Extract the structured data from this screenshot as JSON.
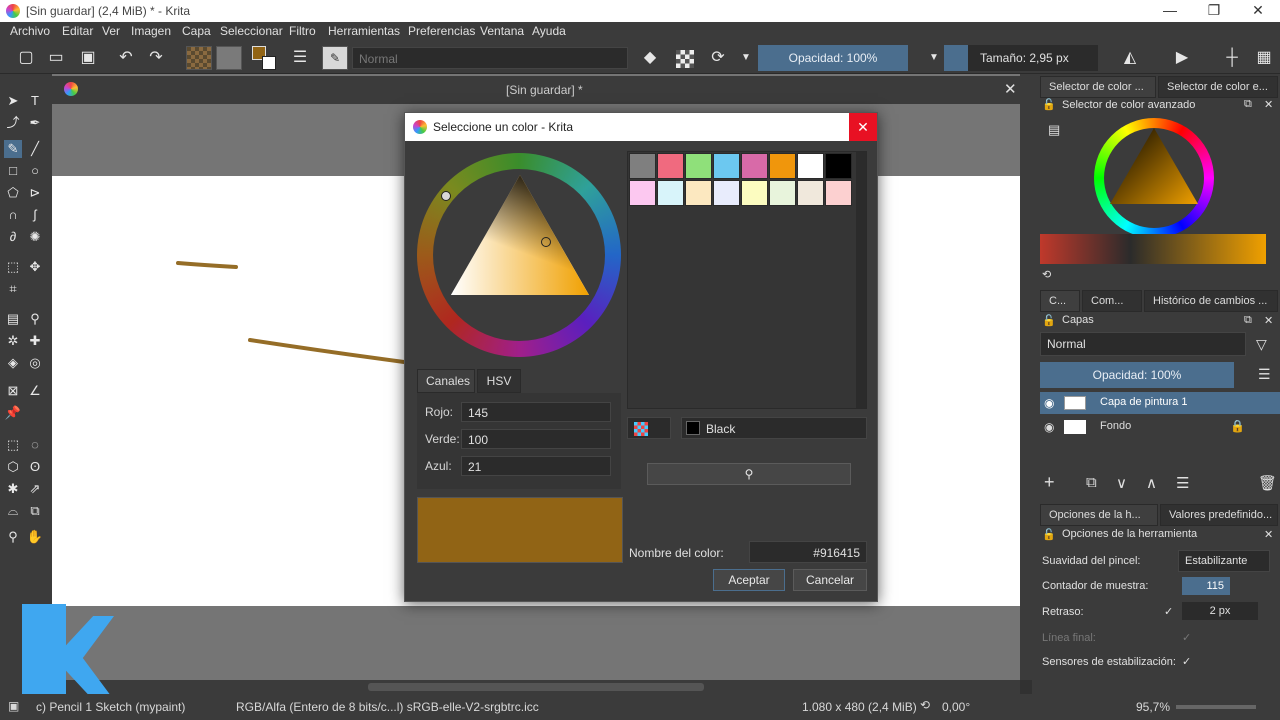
{
  "window": {
    "title": "[Sin guardar]  (2,4 MiB)  * - Krita",
    "min": "—",
    "max": "❐",
    "close": "✕"
  },
  "menu": [
    "Archivo",
    "Editar",
    "Ver",
    "Imagen",
    "Capa",
    "Seleccionar",
    "Filtro",
    "Herramientas",
    "Preferencias",
    "Ventana",
    "Ayuda"
  ],
  "toolbar": {
    "blend_mode": "Normal",
    "opacity": "Opacidad: 100%",
    "size": "Tamaño: 2,95 px"
  },
  "document": {
    "tab_title": "[Sin guardar]  *",
    "close": "✕"
  },
  "right_panel": {
    "top_tabs": [
      "Selector de color ...",
      "Selector de color e..."
    ],
    "color_selector_title": "Selector de color avanzado",
    "mid_tabs": [
      "C...",
      "Com...",
      "Histórico de cambios ..."
    ],
    "layers_title": "Capas",
    "layers_blend": "Normal",
    "layers_opacity": "Opacidad:  100%",
    "layers": [
      {
        "name": "Capa de pintura 1"
      },
      {
        "name": "Fondo"
      }
    ],
    "bottom_tabs": [
      "Opciones de la h...",
      "Valores predefinido..."
    ],
    "tool_options_title": "Opciones de la herramienta",
    "tool_options": {
      "smoothing_label": "Suavidad del pincel:",
      "smoothing_value": "Estabilizante",
      "sample_label": "Contador de muestra:",
      "sample_value": "115",
      "delay_label": "Retraso:",
      "delay_value": "2 px",
      "finish_label": "Línea final:",
      "sensors_label": "Sensores de estabilización:"
    }
  },
  "dialog": {
    "title": "Seleccione un color - Krita",
    "tabs": [
      "Canales",
      "HSV"
    ],
    "channels": [
      {
        "label": "Rojo:",
        "value": "145"
      },
      {
        "label": "Verde:",
        "value": "100"
      },
      {
        "label": "Azul:",
        "value": "21"
      }
    ],
    "current_color": "#916415",
    "palette_name": "Black",
    "color_name_label": "Nombre del color:",
    "color_name_value": "#916415",
    "accept": "Aceptar",
    "cancel": "Cancelar",
    "swatches_row1": [
      "#7f7f7f",
      "#f06a7f",
      "#8fe07a",
      "#6cc8f0",
      "#d86aa8",
      "#f0960c",
      "#ffffff",
      "#000000"
    ],
    "swatches_row2": [
      "#fcc8f0",
      "#d8f4fa",
      "#fce8c0",
      "#e8ecfc",
      "#fcfcc0",
      "#e8f4dc",
      "#f0e8dc",
      "#fcd0d0"
    ]
  },
  "status": {
    "brush": "c) Pencil 1 Sketch (mypaint)",
    "color_model": "RGB/Alfa (Entero de 8 bits/c...l)  sRGB-elle-V2-srgbtrc.icc",
    "dimensions": "1.080 x 480 (2,4 MiB)",
    "rotation": "0,00°",
    "zoom": "95,7%"
  }
}
